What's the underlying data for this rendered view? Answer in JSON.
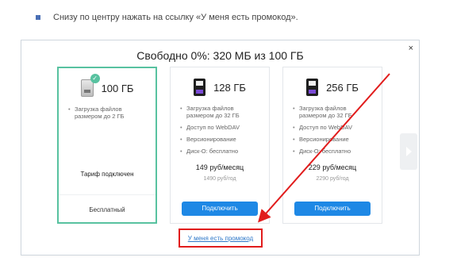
{
  "instruction": {
    "text": "Снизу по центру нажать на ссылку «У меня есть промокод»."
  },
  "dialog": {
    "title": "Свободно 0%: 320 МБ из 100 ГБ",
    "close_label": "×"
  },
  "plans": [
    {
      "size": "100 ГБ",
      "features": [
        "Загрузка файлов размером до 2 ГБ"
      ],
      "status": "Тариф подключен",
      "footer_label": "Бесплатный"
    },
    {
      "size": "128 ГБ",
      "features": [
        "Загрузка файлов размером до 32 ГБ",
        "Доступ по WebDAV",
        "Версионирование",
        "Диск-О: бесплатно"
      ],
      "price": "149 руб/месяц",
      "price_year": "1490 руб/год",
      "button_label": "Подключить"
    },
    {
      "size": "256 ГБ",
      "features": [
        "Загрузка файлов размером до 32 ГБ",
        "Доступ по WebDAV",
        "Версионирование",
        "Диск-О: бесплатно"
      ],
      "price": "229 руб/месяц",
      "price_year": "2290 руб/год",
      "button_label": "Подключить"
    }
  ],
  "promo": {
    "link_label": "У меня есть промокод"
  },
  "colors": {
    "accent_blue": "#1e88e5",
    "active_green": "#58c2a0",
    "highlight_red": "#e11c1c",
    "link_blue": "#2f78c9"
  },
  "icons": {
    "bullet": "square-bullet-icon",
    "free_plan": "disk-check-icon",
    "paid_plan": "sd-card-icon",
    "carousel_next": "chevron-right-icon",
    "annotation": "red-arrow-icon"
  }
}
